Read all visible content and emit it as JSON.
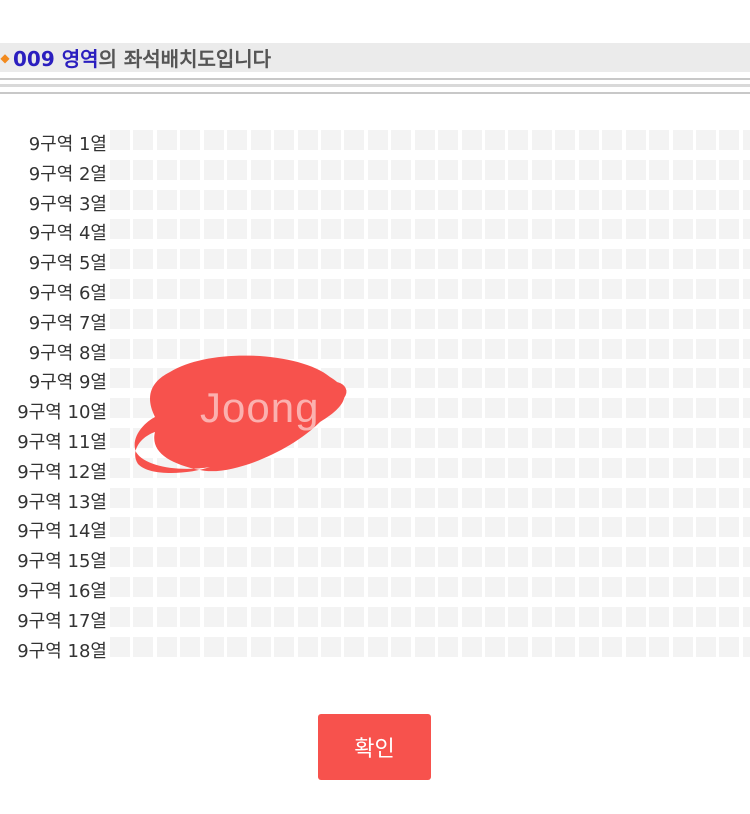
{
  "header": {
    "bullet_icon": "diamond-icon",
    "zone_code": "009 영역",
    "title_rest": "의 좌석배치도입니다"
  },
  "seat_rows": [
    {
      "label": "9구역 1열"
    },
    {
      "label": "9구역 2열"
    },
    {
      "label": "9구역 3열"
    },
    {
      "label": "9구역 4열"
    },
    {
      "label": "9구역 5열"
    },
    {
      "label": "9구역 6열"
    },
    {
      "label": "9구역 7열"
    },
    {
      "label": "9구역 8열"
    },
    {
      "label": "9구역 9열"
    },
    {
      "label": "9구역 10열"
    },
    {
      "label": "9구역 11열"
    },
    {
      "label": "9구역 12열"
    },
    {
      "label": "9구역 13열"
    },
    {
      "label": "9구역 14열"
    },
    {
      "label": "9구역 15열"
    },
    {
      "label": "9구역 16열"
    },
    {
      "label": "9구역 17열"
    },
    {
      "label": "9구역 18열"
    }
  ],
  "watermark": "Joong",
  "confirm_label": "확인",
  "colors": {
    "accent": "#2b1fbf",
    "bullet": "#f28a1e",
    "button": "#f7524d",
    "seat": "#f3f3f3",
    "redaction": "#f7524d"
  }
}
